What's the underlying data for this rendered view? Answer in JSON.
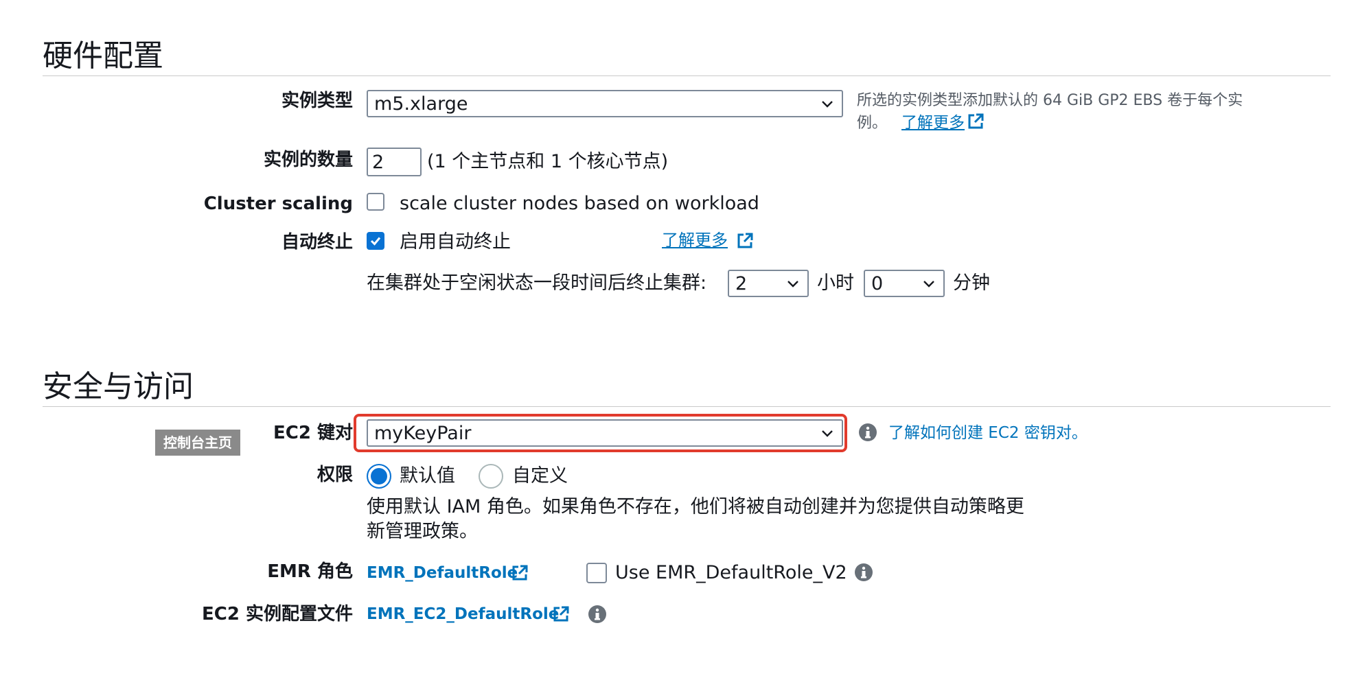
{
  "hardware": {
    "title": "硬件配置",
    "instance_type": {
      "label": "实例类型",
      "value": "m5.xlarge",
      "hint_line1": "所选的实例类型添加默认的 64 GiB GP2 EBS 卷于每个实",
      "hint_line2": "例。",
      "learn_more": "了解更多"
    },
    "instance_count": {
      "label": "实例的数量",
      "value": "2",
      "note": "(1 个主节点和 1 个核心节点)"
    },
    "cluster_scaling": {
      "label": "Cluster scaling",
      "checkbox_label": "scale cluster nodes based on workload",
      "checked": false
    },
    "auto_terminate": {
      "label": "自动终止",
      "checkbox_label": "启用自动终止",
      "checked": true,
      "learn_more": "了解更多",
      "idle_text": "在集群处于空闲状态一段时间后终止集群:",
      "hours_value": "2",
      "hours_unit": "小时",
      "minutes_value": "0",
      "minutes_unit": "分钟"
    }
  },
  "security": {
    "title": "安全与访问",
    "tooltip": "控制台主页",
    "key_pair": {
      "label": "EC2 键对",
      "value": "myKeyPair",
      "help_link": "了解如何创建 EC2 密钥对。"
    },
    "permissions": {
      "label": "权限",
      "option_default": "默认值",
      "option_custom": "自定义",
      "selected": "默认值",
      "description_line1": "使用默认 IAM 角色。如果角色不存在，他们将被自动创建并为您提供自动策略更",
      "description_line2": "新管理政策。"
    },
    "emr_role": {
      "label": "EMR 角色",
      "link": "EMR_DefaultRole",
      "checkbox_label": "Use EMR_DefaultRole_V2",
      "checked": false
    },
    "instance_profile": {
      "label": "EC2 实例配置文件",
      "link": "EMR_EC2_DefaultRole"
    }
  },
  "colors": {
    "link": "#0073bb",
    "checkbox_on": "#0972d3",
    "highlight": "#e13b2d"
  },
  "icons": [
    "chevron-down-icon",
    "external-link-icon",
    "info-icon",
    "checkmark-icon"
  ]
}
